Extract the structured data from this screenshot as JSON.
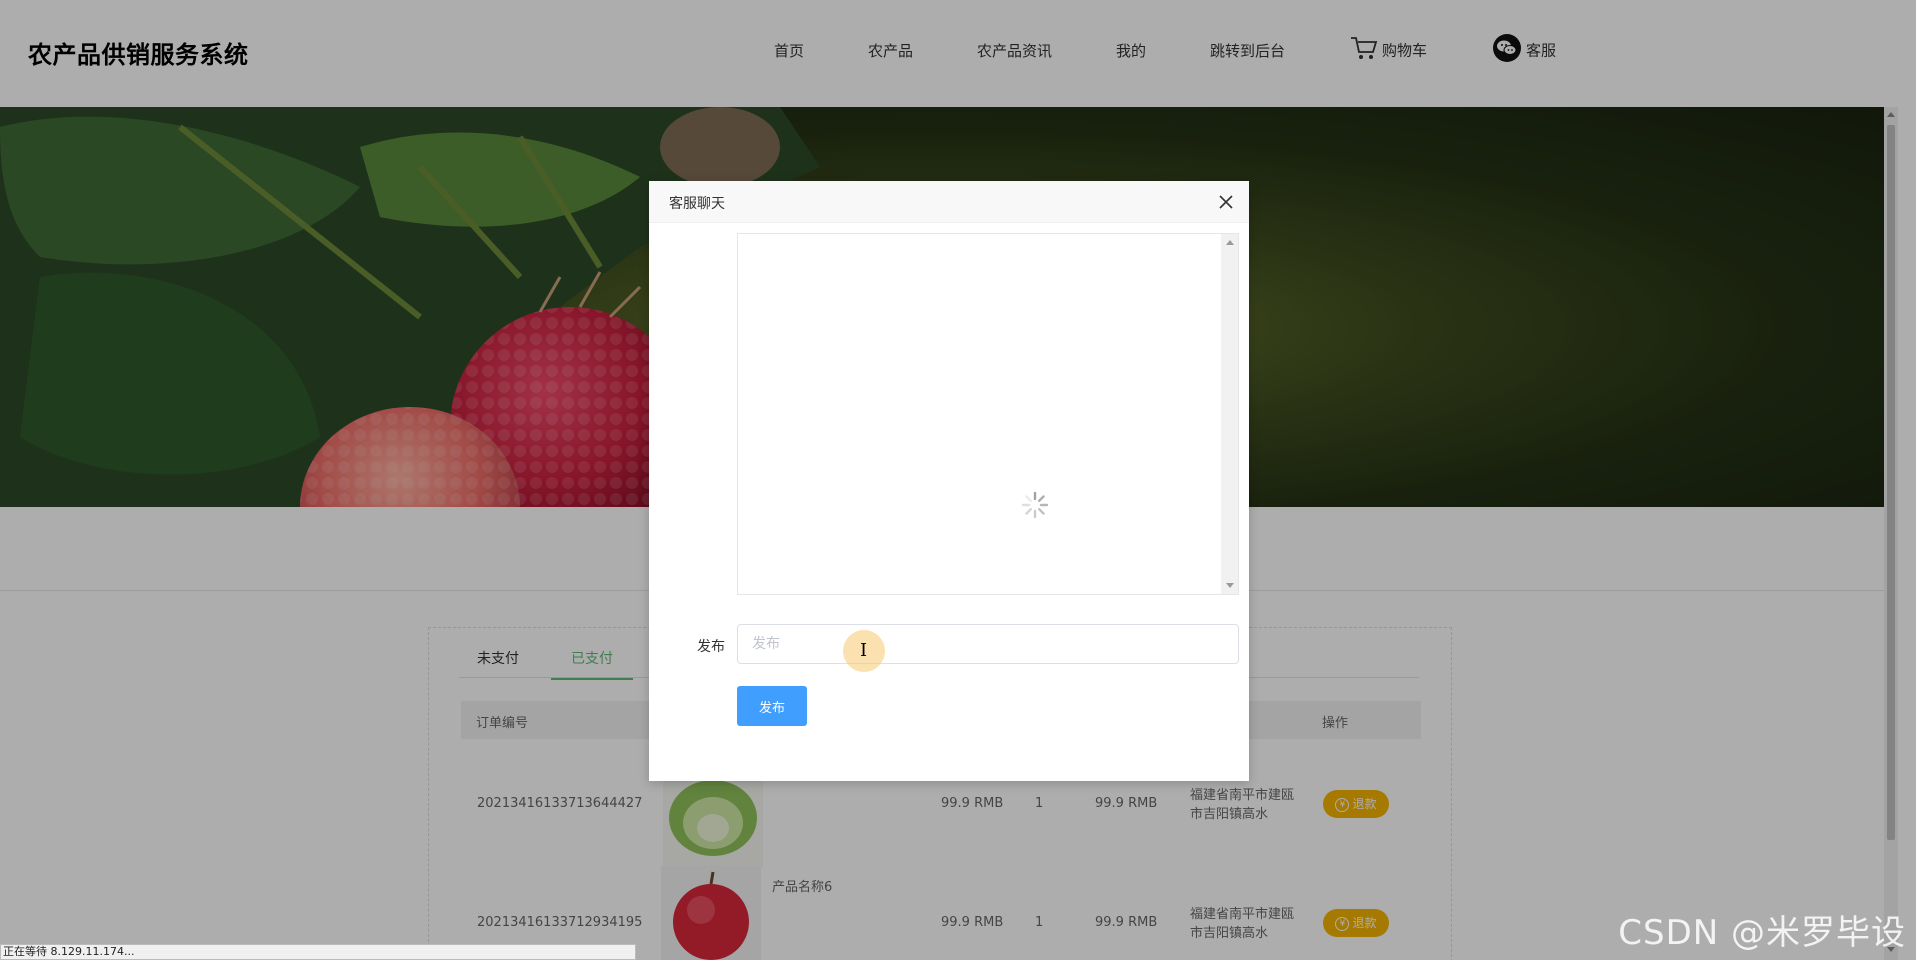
{
  "header": {
    "logo": "农产品供销服务系统",
    "nav": [
      {
        "label": "首页"
      },
      {
        "label": "农产品"
      },
      {
        "label": "农产品资讯"
      },
      {
        "label": "我的"
      },
      {
        "label": "跳转到后台"
      },
      {
        "label": "购物车",
        "icon": "cart-icon"
      },
      {
        "label": "客服",
        "icon": "wechat-icon"
      }
    ]
  },
  "orders": {
    "tabs": [
      {
        "label": "未支付",
        "active": false
      },
      {
        "label": "已支付",
        "active": true
      }
    ],
    "columns": {
      "order_no": "订单编号",
      "action": "操作"
    },
    "rows": [
      {
        "order_no": "20213416133713644427",
        "product": "",
        "price": "99.9 RMB",
        "qty": "1",
        "total": "99.9 RMB",
        "address": "福建省南平市建瓯市吉阳镇高水",
        "action": "退款"
      },
      {
        "order_no": "20213416133712934195",
        "product": "产品名称6",
        "price": "99.9 RMB",
        "qty": "1",
        "total": "99.9 RMB",
        "address": "福建省南平市建瓯市吉阳镇高水",
        "action": "退款"
      }
    ]
  },
  "modal": {
    "title": "客服聊天",
    "form_label": "发布",
    "input_value": "",
    "input_placeholder": "发布",
    "submit_label": "发布"
  },
  "statusbar": "正在等待 8.129.11.174...",
  "watermark": "CSDN @米罗毕设",
  "colors": {
    "accent_green": "#5fb878",
    "primary_blue": "#409eff",
    "refund_yellow": "#f5b400"
  }
}
